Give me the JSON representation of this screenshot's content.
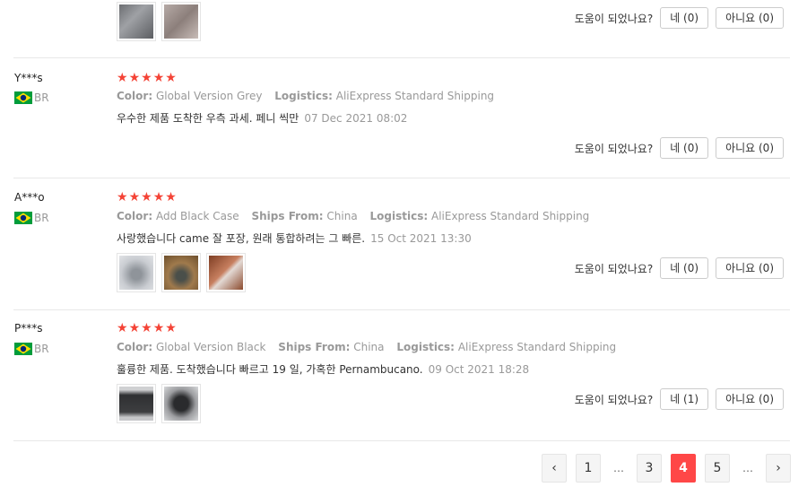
{
  "helpful_label": "도움이 되었나요?",
  "reviews": [
    {
      "thumb_colors": [
        "#7d7f83",
        "#9a8f8c"
      ],
      "yes": "네 (0)",
      "no": "아니요 (0)"
    },
    {
      "name": "Y***s",
      "country": "BR",
      "color_label": "Color:",
      "color_value": "Global Version Grey",
      "logistics_label": "Logistics:",
      "logistics_value": "AliExpress Standard Shipping",
      "text": "우수한 제품 도착한 우측 과세. 페니 씩만",
      "date": "07 Dec 2021 08:02",
      "yes": "네 (0)",
      "no": "아니요 (0)"
    },
    {
      "name": "A***o",
      "country": "BR",
      "color_label": "Color:",
      "color_value": "Add Black Case",
      "ships_label": "Ships From:",
      "ships_value": "China",
      "logistics_label": "Logistics:",
      "logistics_value": "AliExpress Standard Shipping",
      "text": "사랑했습니다 came 잘 포장, 원래 통합하려는 그 빠른.",
      "date": "15 Oct 2021 13:30",
      "thumb_colors": [
        "#b8bcc2",
        "#8a6b45",
        "#9b5a3e"
      ],
      "yes": "네 (0)",
      "no": "아니요 (0)"
    },
    {
      "name": "P***s",
      "country": "BR",
      "color_label": "Color:",
      "color_value": "Global Version Black",
      "ships_label": "Ships From:",
      "ships_value": "China",
      "logistics_label": "Logistics:",
      "logistics_value": "AliExpress Standard Shipping",
      "text": "훌륭한 제품. 도착했습니다 빠르고 19 일, 가혹한 Pernambucano.",
      "date": "09 Oct 2021 18:28",
      "thumb_colors": [
        "#3d3e40",
        "#6e6e70"
      ],
      "yes": "네 (1)",
      "no": "아니요 (0)"
    }
  ],
  "pagination": {
    "prev": "‹",
    "p1": "1",
    "ellipsis": "…",
    "p3": "3",
    "p4": "4",
    "p5": "5",
    "next": "›",
    "current": 4
  },
  "star_char": "★",
  "star_color": "#f44336",
  "accent_color": "#ff4747",
  "flag_colors": {
    "green": "#009c3b",
    "yellow": "#ffdf00",
    "blue": "#002776"
  }
}
